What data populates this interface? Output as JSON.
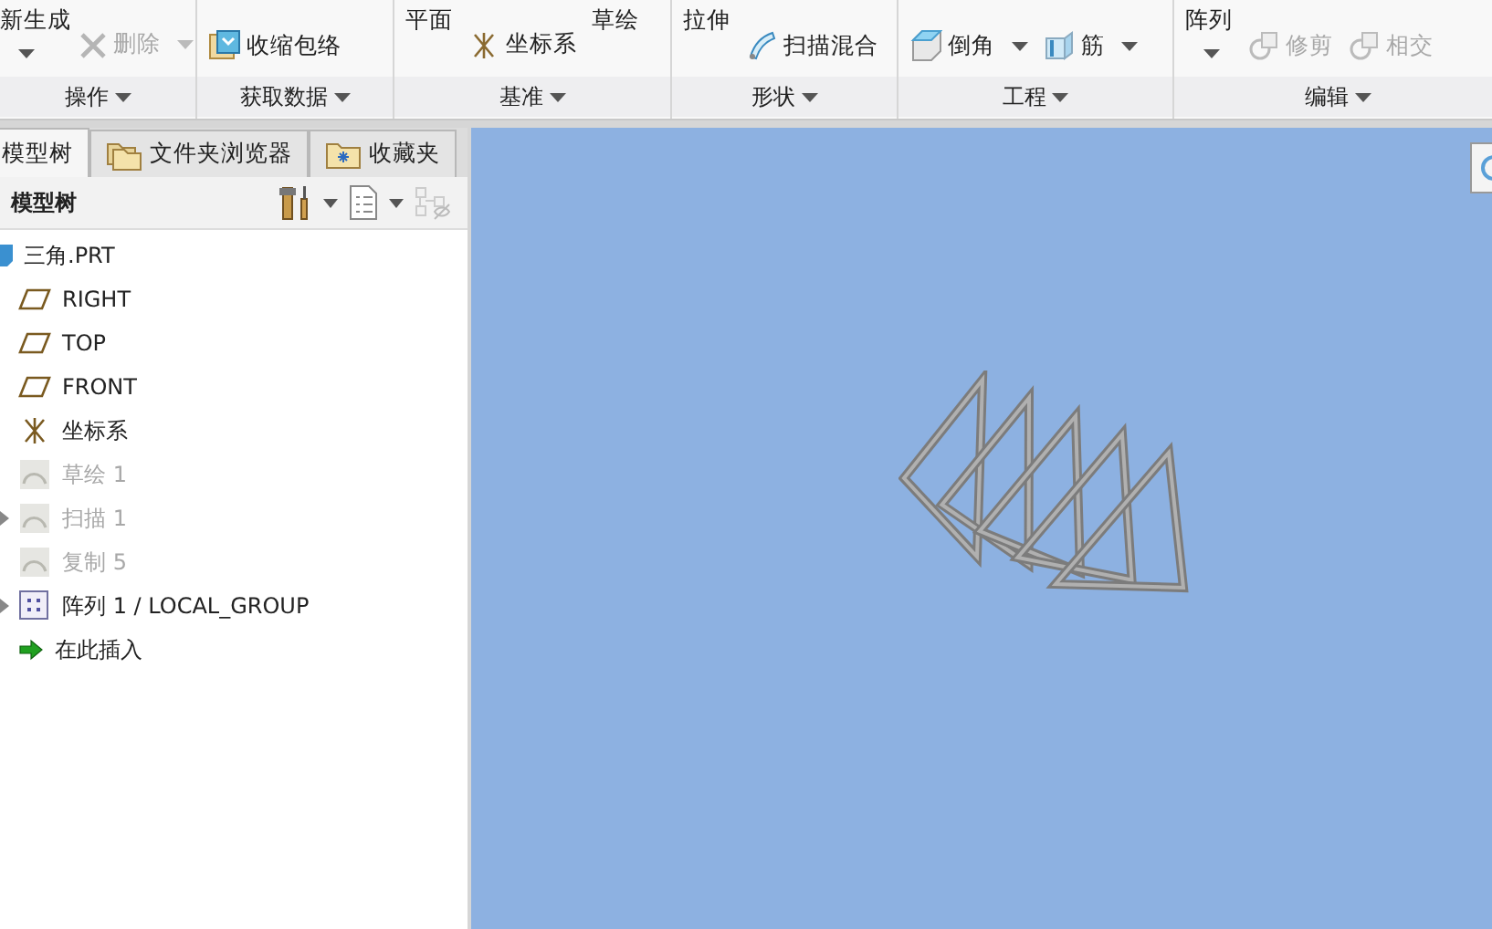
{
  "ribbon": {
    "groups": [
      {
        "label": "操作",
        "columns": [
          [
            {
              "kind": "large",
              "label": "新生成",
              "disabled": false,
              "dropdown": true
            }
          ],
          [
            {
              "kind": "small",
              "label": "删除",
              "disabled": true,
              "dropdown": true
            }
          ]
        ]
      },
      {
        "label": "获取数据",
        "columns": [
          [
            {
              "kind": "small",
              "label": "收缩包络",
              "disabled": false,
              "dropdown": false
            }
          ]
        ]
      },
      {
        "label": "基准",
        "columns": [
          [
            {
              "kind": "large",
              "label": "平面",
              "disabled": false,
              "dropdown": false
            }
          ],
          [
            {
              "kind": "small",
              "label": "坐标系",
              "disabled": false,
              "dropdown": false
            }
          ],
          [
            {
              "kind": "large",
              "label": "草绘",
              "disabled": false,
              "dropdown": false
            }
          ]
        ]
      },
      {
        "label": "形状",
        "columns": [
          [
            {
              "kind": "large",
              "label": "拉伸",
              "disabled": false,
              "dropdown": false
            }
          ],
          [
            {
              "kind": "small",
              "label": "扫描混合",
              "disabled": false,
              "dropdown": false
            }
          ]
        ]
      },
      {
        "label": "工程",
        "columns": [
          [
            {
              "kind": "small",
              "label": "倒角",
              "disabled": false,
              "dropdown": true
            }
          ],
          [
            {
              "kind": "small",
              "label": "筋",
              "disabled": false,
              "dropdown": true
            }
          ]
        ]
      },
      {
        "label": "编辑",
        "columns": [
          [
            {
              "kind": "large",
              "label": "阵列",
              "disabled": false,
              "dropdown": true
            }
          ],
          [
            {
              "kind": "small",
              "label": "修剪",
              "disabled": true,
              "dropdown": false
            }
          ],
          [
            {
              "kind": "small",
              "label": "相交",
              "disabled": true,
              "dropdown": false
            }
          ]
        ]
      }
    ]
  },
  "tabs": [
    {
      "label": "模型树",
      "selected": true
    },
    {
      "label": "文件夹浏览器",
      "selected": false
    },
    {
      "label": "收藏夹",
      "selected": false
    }
  ],
  "panel": {
    "title": "模型树"
  },
  "tree": [
    {
      "label": "三角.PRT",
      "disabled": false,
      "expandable": false,
      "children": [
        {
          "label": "RIGHT",
          "disabled": false,
          "expandable": false
        },
        {
          "label": "TOP",
          "disabled": false,
          "expandable": false
        },
        {
          "label": "FRONT",
          "disabled": false,
          "expandable": false
        },
        {
          "label": "坐标系",
          "disabled": false,
          "expandable": false
        },
        {
          "label": "草绘 1",
          "disabled": true,
          "expandable": false
        },
        {
          "label": "扫描 1",
          "disabled": true,
          "expandable": true
        },
        {
          "label": "复制 5",
          "disabled": true,
          "expandable": false
        },
        {
          "label": "阵列 1 / LOCAL_GROUP",
          "disabled": false,
          "expandable": true
        },
        {
          "label": "在此插入",
          "disabled": false,
          "expandable": false
        }
      ]
    }
  ]
}
